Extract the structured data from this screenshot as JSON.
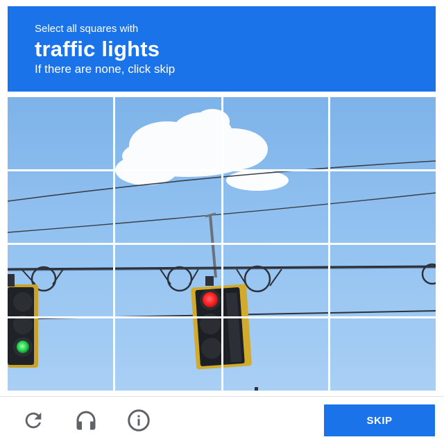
{
  "header": {
    "instruction": "Select all squares with",
    "target": "traffic lights",
    "hint": "If there are none, click skip",
    "background": "#1a73e8"
  },
  "grid": {
    "rows": 3,
    "cols": 4,
    "tile_label_prefix": "image tile"
  },
  "footer": {
    "reload_icon": "reload-icon",
    "audio_icon": "headphones-icon",
    "info_icon": "info-icon",
    "skip_label": "SKIP"
  },
  "colors": {
    "accent": "#1a73e8",
    "icon": "#5f6368",
    "sky": "#93c2f1"
  }
}
